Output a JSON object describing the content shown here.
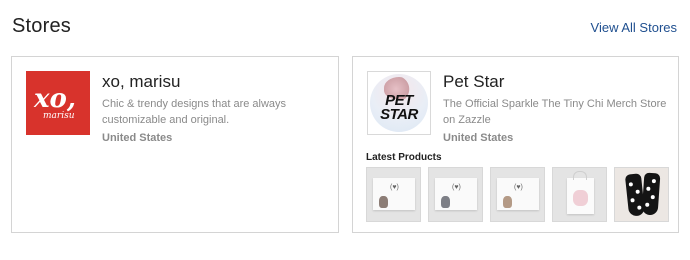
{
  "header": {
    "title": "Stores",
    "view_all_label": "View All Stores"
  },
  "stores": [
    {
      "name": "xo, marisu",
      "logo_text": "xo,",
      "logo_subtext": "marisu",
      "logo_bg": "#d8332c",
      "description": "Chic & trendy designs that are always customizable and original.",
      "country": "United States"
    },
    {
      "name": "Pet Star",
      "logo_text_line1": "PET",
      "logo_text_line2": "STAR",
      "description": "The Official Sparkle The Tiny Chi Merch Store on Zazzle",
      "country": "United States",
      "latest_products_label": "Latest Products",
      "products": [
        {
          "kind": "note-card",
          "icon": "card-product"
        },
        {
          "kind": "note-card",
          "icon": "card-product"
        },
        {
          "kind": "note-card",
          "icon": "card-product"
        },
        {
          "kind": "tote-bag",
          "icon": "bag-product"
        },
        {
          "kind": "socks",
          "icon": "socks-product"
        }
      ]
    }
  ],
  "colors": {
    "link": "#1f4f8f",
    "muted_text": "#8a8a8a",
    "border": "#d4d4d4"
  }
}
